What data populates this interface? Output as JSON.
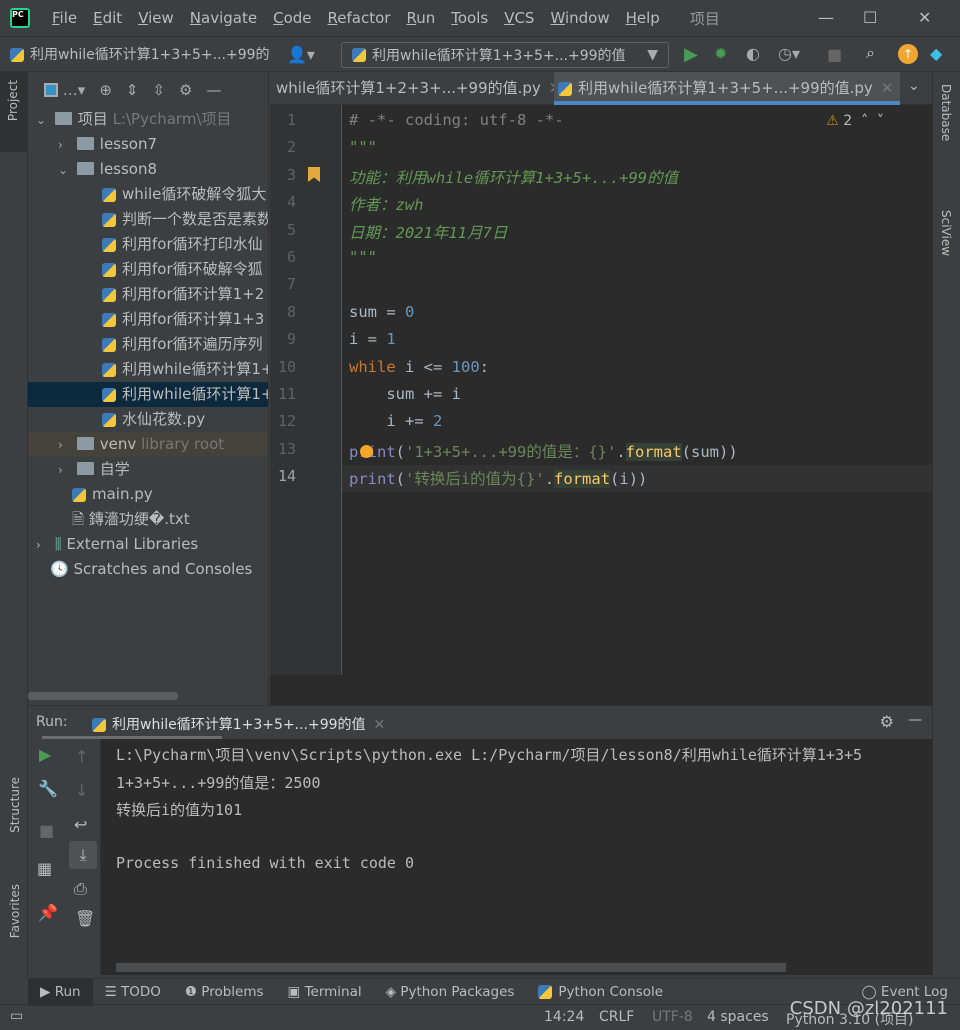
{
  "menu": [
    "File",
    "Edit",
    "View",
    "Navigate",
    "Code",
    "Refactor",
    "Run",
    "Tools",
    "VCS",
    "Window",
    "Help"
  ],
  "project_title": "项目",
  "toolbar": {
    "breadcrumb": "利用while循环计算1+3+5+...+99的",
    "run_config": "利用while循环计算1+3+5+...+99的值"
  },
  "left_stripe": {
    "project": "Project",
    "structure": "Structure",
    "favorites": "Favorites"
  },
  "right_stripe": {
    "database": "Database",
    "sciview": "SciView"
  },
  "tree": [
    {
      "label": "项目",
      "extra": "L:\\Pycharm\\项目",
      "depth": 0,
      "type": "folder",
      "open": true
    },
    {
      "label": "lesson7",
      "depth": 1,
      "type": "folder",
      "open": false
    },
    {
      "label": "lesson8",
      "depth": 1,
      "type": "folder",
      "open": true
    },
    {
      "label": "while循环破解令狐大",
      "depth": 2,
      "type": "py"
    },
    {
      "label": "判断一个数是否是素数",
      "depth": 2,
      "type": "py"
    },
    {
      "label": "利用for循环打印水仙",
      "depth": 2,
      "type": "py"
    },
    {
      "label": "利用for循环破解令狐",
      "depth": 2,
      "type": "py"
    },
    {
      "label": "利用for循环计算1+2",
      "depth": 2,
      "type": "py"
    },
    {
      "label": "利用for循环计算1+3",
      "depth": 2,
      "type": "py"
    },
    {
      "label": "利用for循环遍历序列",
      "depth": 2,
      "type": "py"
    },
    {
      "label": "利用while循环计算1+",
      "depth": 2,
      "type": "py"
    },
    {
      "label": "利用while循环计算1+",
      "depth": 2,
      "type": "py",
      "selected": true
    },
    {
      "label": "水仙花数.py",
      "depth": 2,
      "type": "py"
    },
    {
      "label": "venv",
      "extra": "library root",
      "depth": 1,
      "type": "folder",
      "open": false,
      "lib": true
    },
    {
      "label": "自学",
      "depth": 1,
      "type": "folder",
      "open": false
    },
    {
      "label": "main.py",
      "depth": 1,
      "type": "py"
    },
    {
      "label": "鏄濇功绠�.txt",
      "depth": 1,
      "type": "txt"
    },
    {
      "label": "External Libraries",
      "depth": 0,
      "type": "lib",
      "open": false
    },
    {
      "label": "Scratches and Consoles",
      "depth": 0,
      "type": "scratch"
    }
  ],
  "tabs": [
    {
      "label": "while循环计算1+2+3+...+99的值.py"
    },
    {
      "label": "利用while循环计算1+3+5+...+99的值.py",
      "active": true
    }
  ],
  "editor": {
    "warnings": "2",
    "current_line": 14,
    "lines": [
      [
        {
          "t": "# -*- coding: utf-8 -*-",
          "c": "cm"
        }
      ],
      [
        {
          "t": "\"\"\"",
          "c": "doc"
        }
      ],
      [
        {
          "t": "功能：利用while循环计算1+3+5+...+99的值",
          "c": "doc"
        }
      ],
      [
        {
          "t": "作者：zwh",
          "c": "doc"
        }
      ],
      [
        {
          "t": "日期：2021年11月7日",
          "c": "doc"
        }
      ],
      [
        {
          "t": "\"\"\"",
          "c": "doc"
        }
      ],
      [],
      [
        {
          "t": "sum",
          "c": ""
        },
        {
          "t": " = ",
          "c": ""
        },
        {
          "t": "0",
          "c": "num"
        }
      ],
      [
        {
          "t": "i = ",
          "c": ""
        },
        {
          "t": "1",
          "c": "num"
        }
      ],
      [
        {
          "t": "while",
          "c": "kw"
        },
        {
          "t": " i <= ",
          "c": ""
        },
        {
          "t": "100",
          "c": "num"
        },
        {
          "t": ":",
          "c": ""
        }
      ],
      [
        {
          "t": "    sum += i",
          "c": ""
        }
      ],
      [
        {
          "t": "    i += ",
          "c": ""
        },
        {
          "t": "2",
          "c": "num"
        }
      ],
      [
        {
          "t": "print",
          "c": "fn"
        },
        {
          "t": "(",
          "c": ""
        },
        {
          "t": "'1+3+5+...+99的值是：{}'",
          "c": "str"
        },
        {
          "t": ".",
          "c": ""
        },
        {
          "t": "format",
          "c": "meth"
        },
        {
          "t": "(sum))",
          "c": ""
        }
      ],
      [
        {
          "t": "print",
          "c": "fn"
        },
        {
          "t": "(",
          "c": ""
        },
        {
          "t": "'转换后i的值为{}'",
          "c": "str"
        },
        {
          "t": ".",
          "c": ""
        },
        {
          "t": "format",
          "c": "meth"
        },
        {
          "t": "(i))",
          "c": ""
        }
      ]
    ]
  },
  "run": {
    "label": "Run:",
    "tab": "利用while循环计算1+3+5+...+99的值",
    "output": [
      "L:\\Pycharm\\项目\\venv\\Scripts\\python.exe L:/Pycharm/项目/lesson8/利用while循环计算1+3+5",
      "1+3+5+...+99的值是：2500",
      "转换后i的值为101",
      "",
      "Process finished with exit code 0"
    ]
  },
  "bottom_tabs": [
    "Run",
    "TODO",
    "Problems",
    "Terminal",
    "Python Packages",
    "Python Console"
  ],
  "event_log": "Event Log",
  "status": {
    "position": "14:24",
    "line_sep": "CRLF",
    "encoding": "UTF-8",
    "indent": "4 spaces",
    "interpreter": "Python 3.10 (项目)"
  },
  "watermark": "CSDN @zl202111"
}
